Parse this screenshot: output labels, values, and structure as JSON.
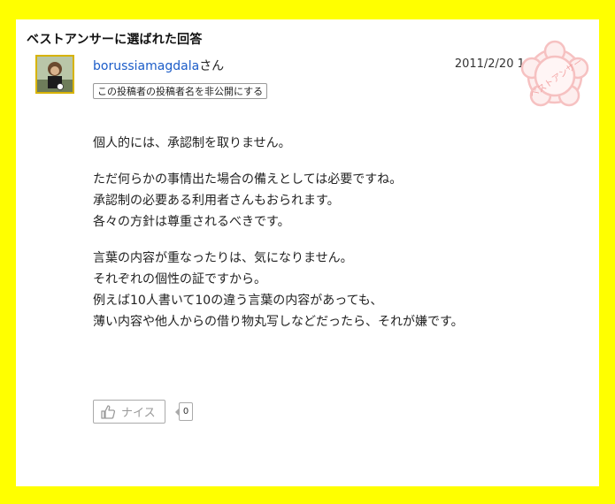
{
  "header": {
    "title": "ベストアンサーに選ばれた回答"
  },
  "answer": {
    "username": "borussiamagdala",
    "honorific": "さん",
    "datetime": "2011/2/20  18:57:49",
    "hide_button": "この投稿者の投稿者名を非公開にする",
    "stamp_text": "ベストアンサー",
    "paragraphs": [
      [
        "個人的には、承認制を取りません。"
      ],
      [
        "ただ何らかの事情出た場合の備えとしては必要ですね。",
        "承認制の必要ある利用者さんもおられます。",
        "各々の方針は尊重されるべきです。"
      ],
      [
        "言葉の内容が重なったりは、気になりません。",
        "それぞれの個性の証ですから。",
        "例えば10人書いて10の違う言葉の内容があっても、",
        "薄い内容や他人からの借り物丸写しなどだったら、それが嫌です。"
      ]
    ]
  },
  "actions": {
    "nice_label": "ナイス",
    "nice_count": "0"
  },
  "colors": {
    "frame": "#ffff00",
    "link": "#1b5cc8",
    "stamp": "#f6c1c1"
  },
  "icons": {
    "stamp": "best-answer-stamp-icon",
    "thumb": "thumbs-up-icon"
  }
}
